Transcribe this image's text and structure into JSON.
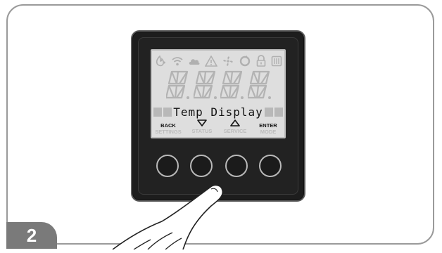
{
  "step_number": "2",
  "lcd": {
    "status_icons": [
      "flame-icon",
      "wifi-icon",
      "cloud-icon",
      "warning-icon",
      "fan-icon",
      "recycle-icon",
      "lock-icon",
      "heater-icon"
    ],
    "segment_display": "88.88.88.88.",
    "message": "Temp Display"
  },
  "buttons": [
    {
      "primary": "BACK",
      "secondary": "SETTINGS",
      "icon": "none"
    },
    {
      "primary": "",
      "secondary": "STATUS",
      "icon": "down-arrow-icon"
    },
    {
      "primary": "",
      "secondary": "SERVICE",
      "icon": "up-arrow-icon"
    },
    {
      "primary": "ENTER",
      "secondary": "MODE",
      "icon": "none"
    }
  ],
  "colors": {
    "lcd_background": "#dedede",
    "bezel": "#1d1d1d",
    "badge": "#7a7a7a"
  }
}
